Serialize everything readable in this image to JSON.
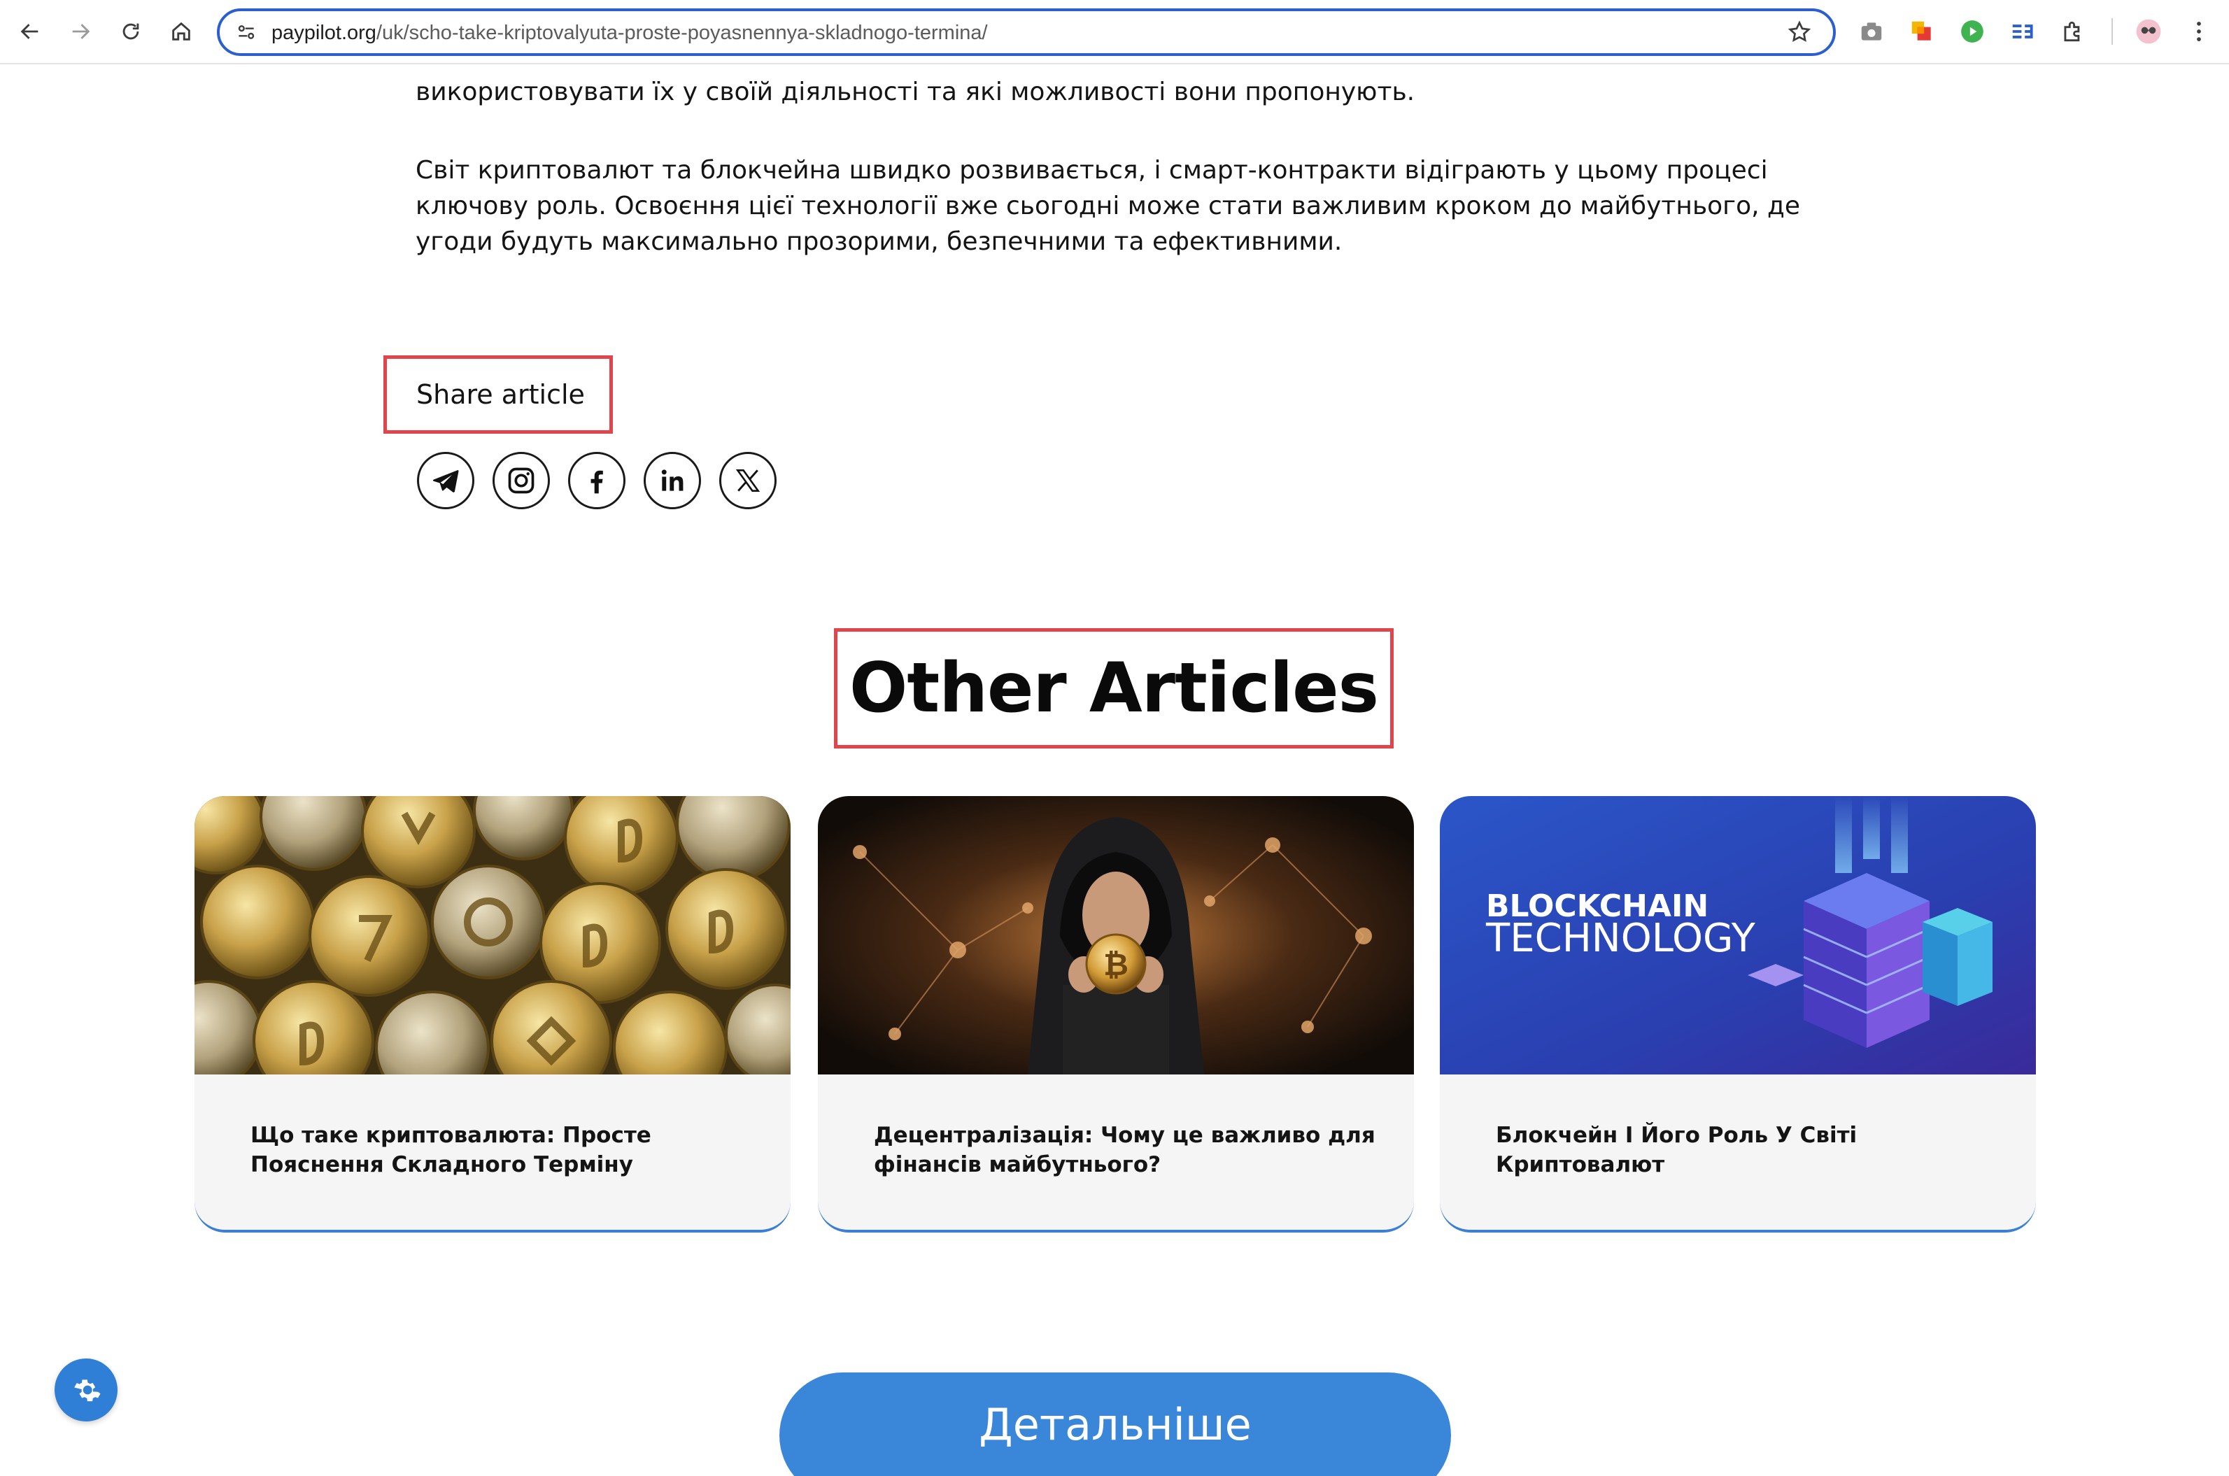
{
  "browser": {
    "url_host": "paypilot.org",
    "url_path": "/uk/scho-take-kriptovalyuta-proste-poyasnennya-skladnogo-termina/"
  },
  "article": {
    "paragraph_1": "використовувати їх у своїй діяльності та які можливості вони пропонують.",
    "paragraph_2": "Світ криптовалют та блокчейна швидко розвивається, і смарт-контракти відіграють у цьому процесі ключову роль. Освоєння цієї технології вже сьогодні може стати важливим кроком до майбутнього, де угоди будуть максимально прозорими, безпечними та ефективними."
  },
  "share": {
    "title": "Share article",
    "icons": [
      "telegram-icon",
      "instagram-icon",
      "facebook-icon",
      "linkedin-icon",
      "x-icon"
    ]
  },
  "other_articles": {
    "title": "Other Articles",
    "cards": [
      {
        "title": "Що таке криптовалюта: Просте Пояснення Складного Терміну",
        "image": "crypto-coins-image"
      },
      {
        "title": "Децентралізація: Чому це важливо для фінансів майбутнього?",
        "image": "hooded-man-bitcoin-image"
      },
      {
        "title": "Блокчейн І Його Роль У Світі Криптовалют",
        "image": "blockchain-technology-image",
        "image_text_1": "BLOCKCHAIN",
        "image_text_2": "TECHNOLOGY"
      }
    ]
  },
  "cta": {
    "label": "Детальніше"
  },
  "colors": {
    "accent": "#3a86d8",
    "highlight_border": "#e0454c",
    "card_bg": "#f5f5f5"
  }
}
